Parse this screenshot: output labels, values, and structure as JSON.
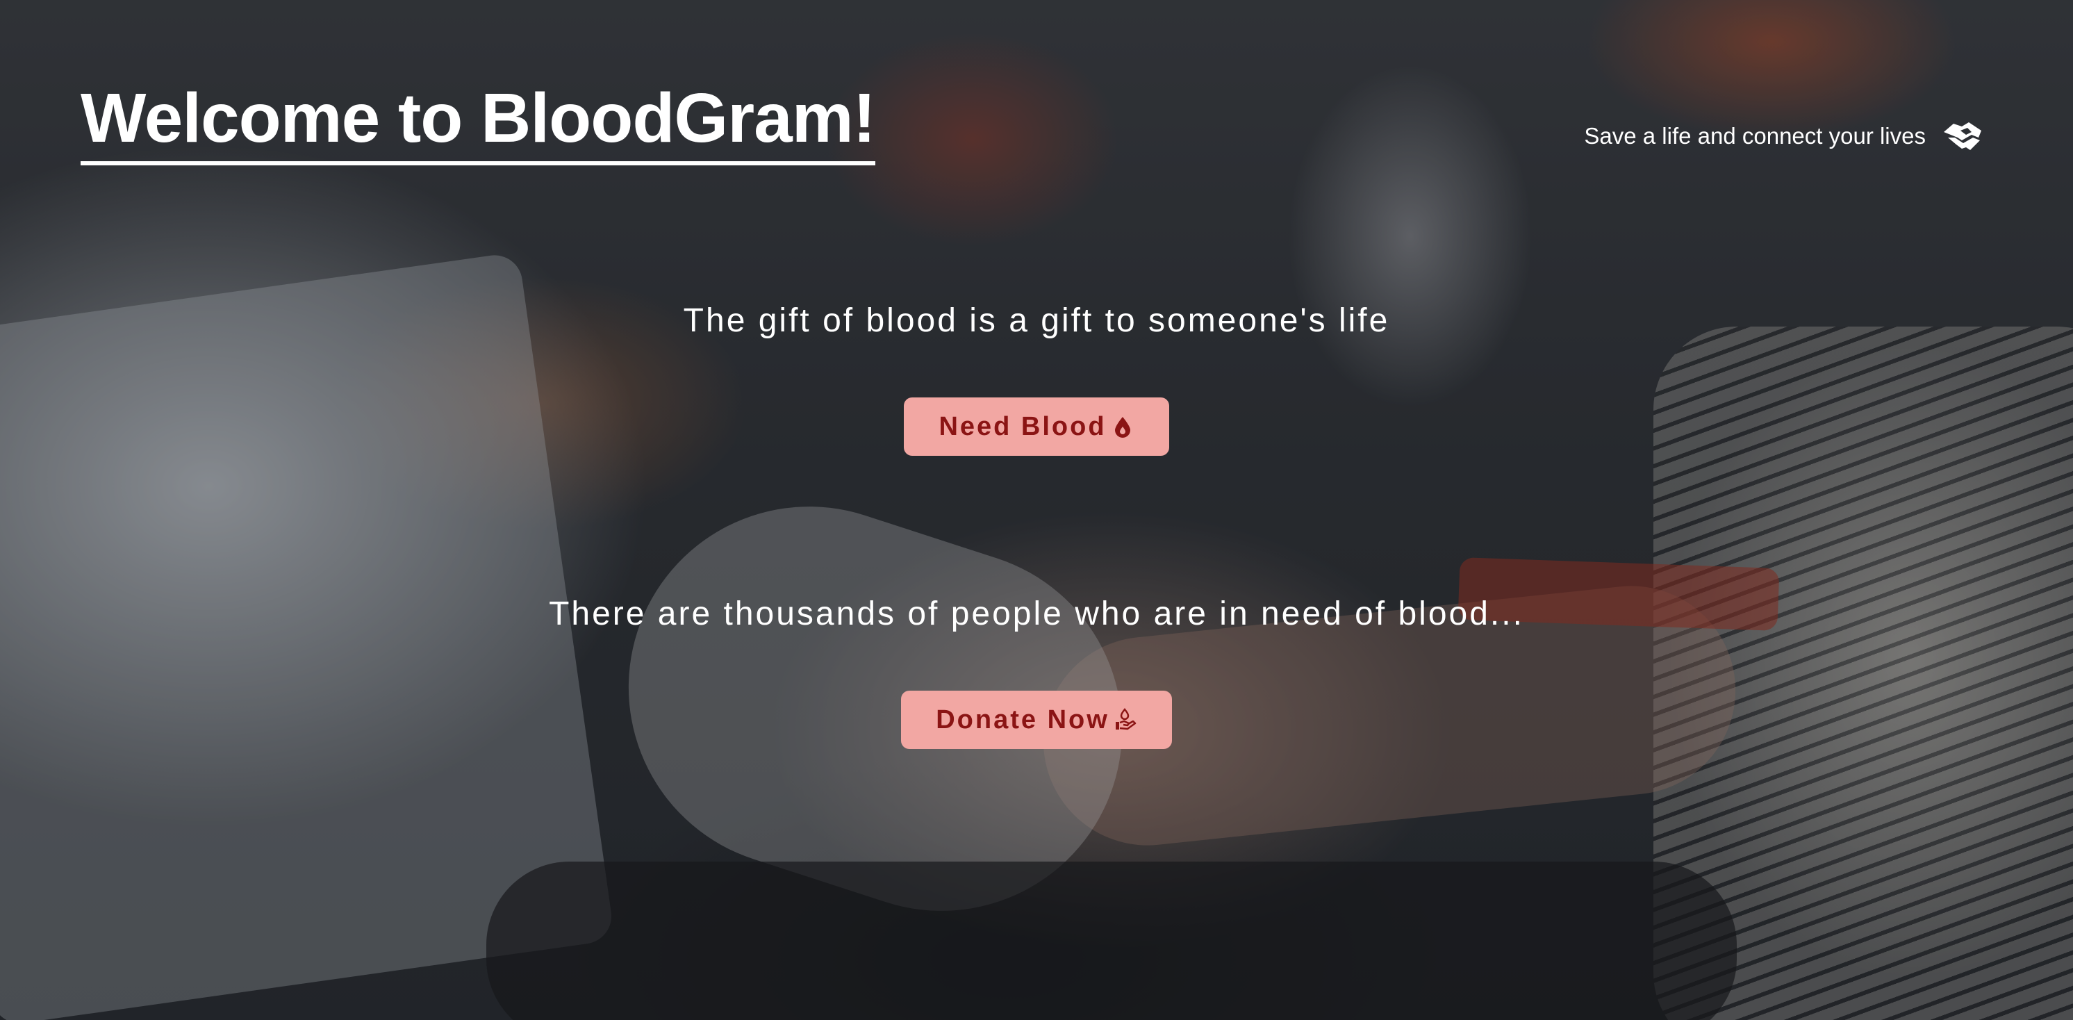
{
  "header": {
    "title": "Welcome to BloodGram!",
    "tagline": "Save a life and connect your lives",
    "tagline_icon": "handshake-icon"
  },
  "sections": [
    {
      "heading": "The gift of blood is a gift to someone's life",
      "button_label": "Need Blood",
      "button_icon": "blood-drop-icon"
    },
    {
      "heading": "There are thousands of people who are in need of blood...",
      "button_label": "Donate Now",
      "button_icon": "hand-donate-icon"
    }
  ],
  "colors": {
    "button_bg": "#f2a7a3",
    "button_text": "#8b1414",
    "text": "#ffffff"
  }
}
